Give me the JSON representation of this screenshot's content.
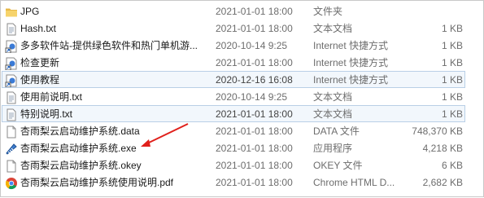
{
  "files": [
    {
      "name": "JPG",
      "date": "2021-01-01 18:00",
      "type": "文件夹",
      "size": "",
      "icon": "folder-icon"
    },
    {
      "name": "Hash.txt",
      "date": "2021-01-01 18:00",
      "type": "文本文档",
      "size": "1 KB",
      "icon": "text-file-icon"
    },
    {
      "name": "多多软件站-提供绿色软件和热门单机游...",
      "date": "2020-10-14 9:25",
      "type": "Internet 快捷方式",
      "size": "1 KB",
      "icon": "internet-shortcut-icon"
    },
    {
      "name": "检查更新",
      "date": "2021-01-01 18:00",
      "type": "Internet 快捷方式",
      "size": "1 KB",
      "icon": "internet-shortcut-icon"
    },
    {
      "name": "使用教程",
      "date": "2020-12-16 16:08",
      "type": "Internet 快捷方式",
      "size": "1 KB",
      "icon": "internet-shortcut-icon"
    },
    {
      "name": "使用前说明.txt",
      "date": "2020-10-14 9:25",
      "type": "文本文档",
      "size": "1 KB",
      "icon": "text-file-icon"
    },
    {
      "name": "特别说明.txt",
      "date": "2021-01-01 18:00",
      "type": "文本文档",
      "size": "1 KB",
      "icon": "text-file-icon"
    },
    {
      "name": "杏雨梨云启动维护系统.data",
      "date": "2021-01-01 18:00",
      "type": "DATA 文件",
      "size": "748,370 KB",
      "icon": "generic-file-icon"
    },
    {
      "name": "杏雨梨云启动维护系统.exe",
      "date": "2021-01-01 18:00",
      "type": "应用程序",
      "size": "4,218 KB",
      "icon": "application-icon"
    },
    {
      "name": "杏雨梨云启动维护系统.okey",
      "date": "2021-01-01 18:00",
      "type": "OKEY 文件",
      "size": "6 KB",
      "icon": "generic-file-icon"
    },
    {
      "name": "杏雨梨云启动维护系统使用说明.pdf",
      "date": "2021-01-01 18:00",
      "type": "Chrome HTML D...",
      "size": "2,682 KB",
      "icon": "chrome-pdf-icon"
    }
  ],
  "colors": {
    "hover_border": "#b9cfe6",
    "hover_bg": "#f2f7fc",
    "arrow": "#e0201b",
    "muted_text": "#6d6d6d"
  }
}
